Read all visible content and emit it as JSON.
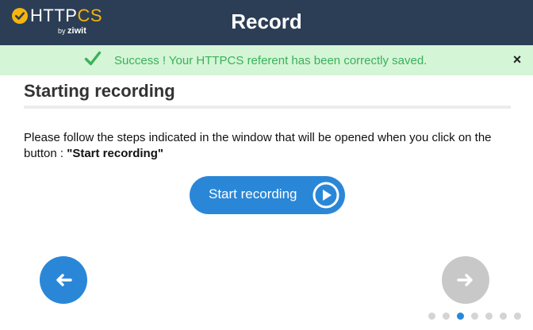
{
  "header": {
    "logo": {
      "brand_main": "HTTP",
      "brand_accent": "CS",
      "by": "by",
      "company": "ziwit"
    },
    "title": "Record"
  },
  "alert": {
    "message": "Success ! Your HTTPCS referent has been correctly saved.",
    "close_label": "×",
    "icon": "checkmark-icon",
    "color": "#3ab15b",
    "background": "#d4f5d6"
  },
  "section": {
    "title": "Starting recording",
    "instruction_text": "Please follow the steps indicated in the window that will be opened when you click on the button : ",
    "instruction_strong": "\"Start recording\""
  },
  "start_button": {
    "label": "Start recording",
    "icon": "play-circle-icon",
    "color": "#2a87d8"
  },
  "navigation": {
    "prev_icon": "arrow-left-icon",
    "next_icon": "arrow-right-icon",
    "prev_color": "#2a87d8",
    "next_color": "#c8c8c8"
  },
  "pagination": {
    "total": 7,
    "current": 3
  },
  "colors": {
    "header_bg": "#2c3e55",
    "accent": "#f6b40e"
  }
}
